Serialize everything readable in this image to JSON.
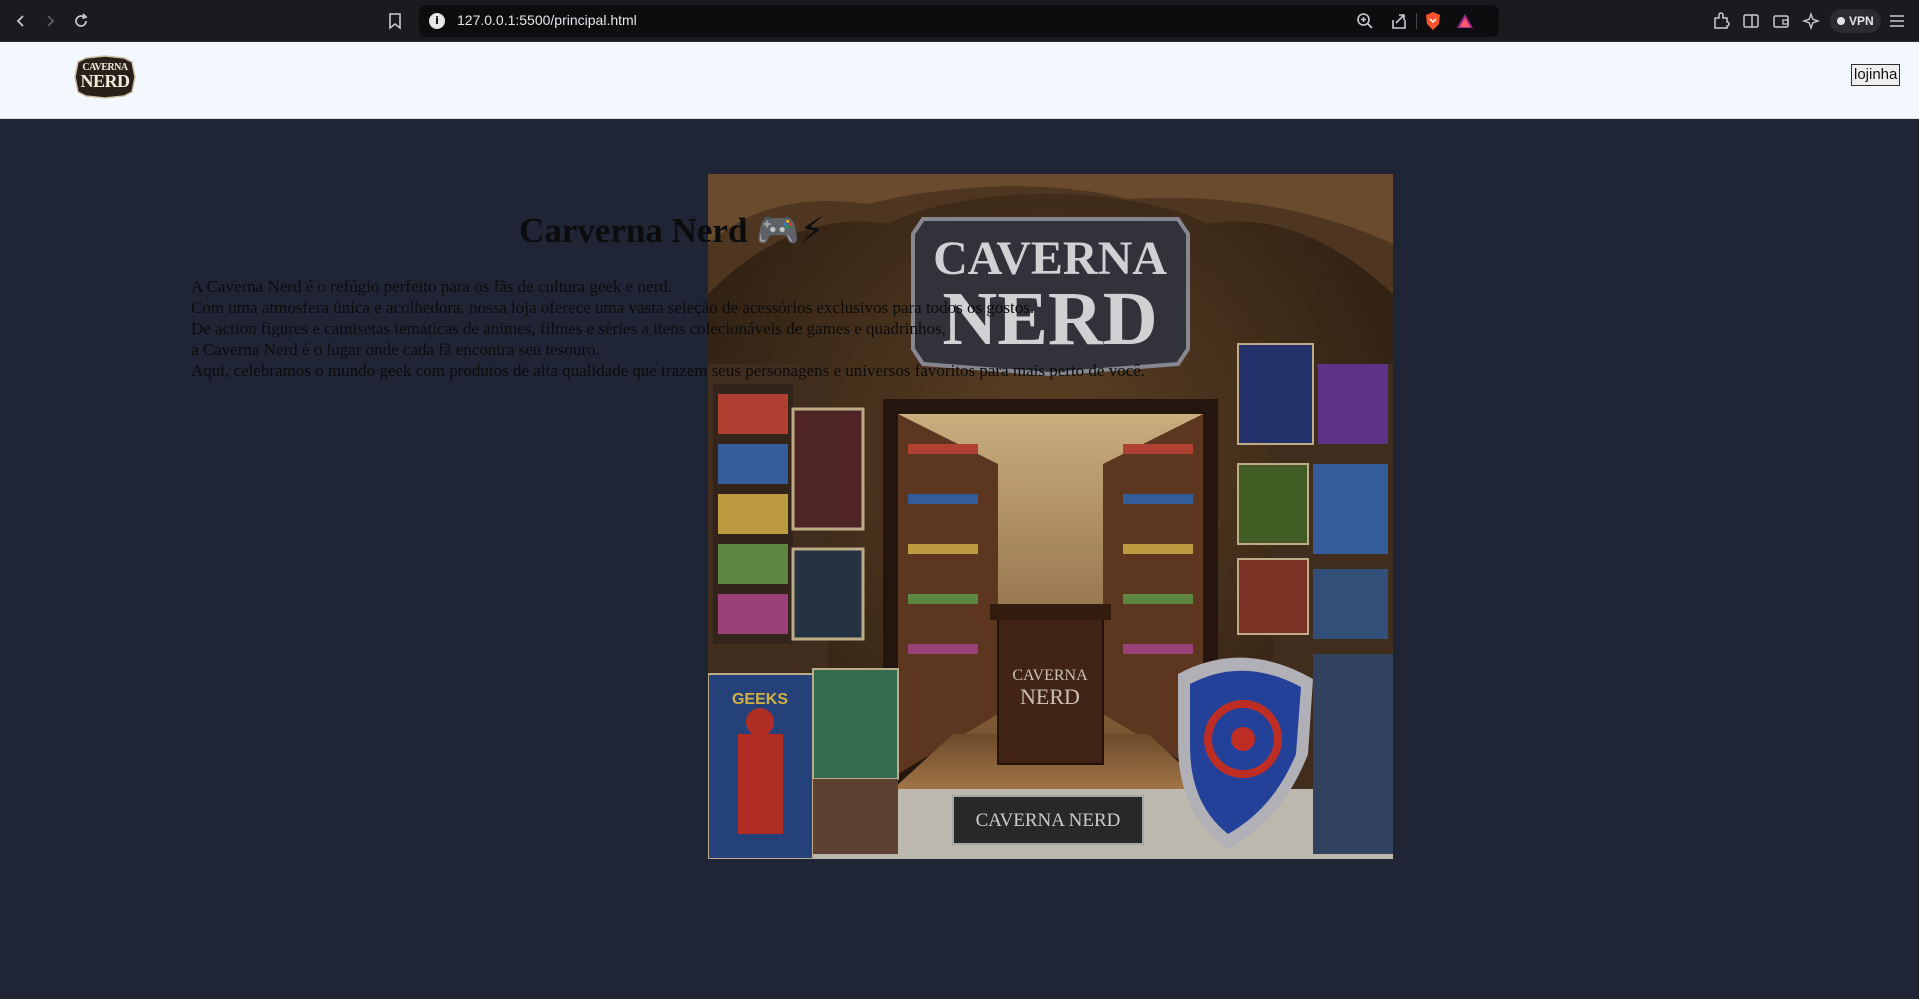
{
  "browser": {
    "url": "127.0.0.1:5500/principal.html",
    "vpn_label": "VPN"
  },
  "header": {
    "logo_line1": "CAVERNA",
    "logo_line2": "NERD",
    "store_button": "lojinha"
  },
  "hero": {
    "title": "Carverna Nerd",
    "title_emoji": "🎮⚡",
    "paragraphs": [
      "A Caverna Nerd é o refúgio perfeito para os fãs de cultura geek e nerd.",
      "Com uma atmosfera única e acolhedora, nossa loja oferece uma vasta seleção de acessórios exclusivos para todos os gostos.",
      "De action figures e camisetas temáticas de animes, filmes e séries a itens colecionáveis de games e quadrinhos,",
      "a Caverna Nerd é o lugar onde cada fã encontra seu tesouro.",
      "Aqui, celebramos o mundo geek com produtos de alta qualidade que trazem seus personagens e universos favoritos para mais perto de você."
    ],
    "image": {
      "sign_line1": "CAVERNA",
      "sign_line2": "NERD",
      "counter_line1": "CAVERNA",
      "counter_line2": "NERD",
      "mat_label": "CAVERNA NERD",
      "box_label": "GEEKS"
    }
  },
  "colors": {
    "page_bg": "#1f2535",
    "header_bg": "#f3f8fe",
    "chrome_bg": "#1b1b1f"
  }
}
